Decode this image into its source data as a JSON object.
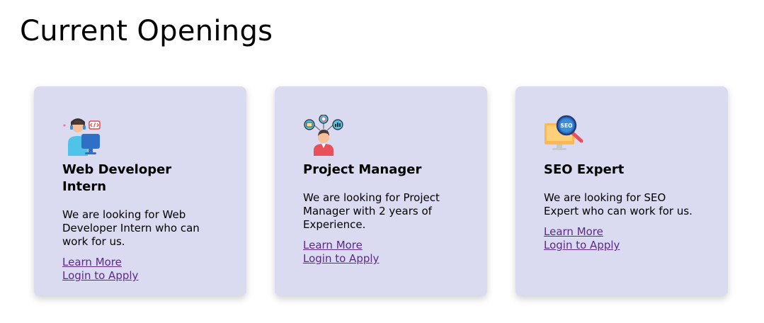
{
  "page": {
    "title": "Current Openings"
  },
  "jobs": [
    {
      "title": "Web Developer Intern",
      "description": "We are looking for Web Developer Intern who can work for us.",
      "learn_more": "Learn More",
      "apply": "Login to Apply",
      "icon": "developer-icon"
    },
    {
      "title": "Project Manager",
      "description": "We are looking for Project Manager with 2 years of Experience.",
      "learn_more": "Learn More",
      "apply": "Login to Apply",
      "icon": "project-manager-icon"
    },
    {
      "title": "SEO Expert",
      "description": "We are looking for SEO Expert who can work for us.",
      "learn_more": "Learn More",
      "apply": "Login to Apply",
      "icon": "seo-icon"
    }
  ],
  "colors": {
    "card_background": "#dadaf0",
    "link": "#5b2a86"
  }
}
